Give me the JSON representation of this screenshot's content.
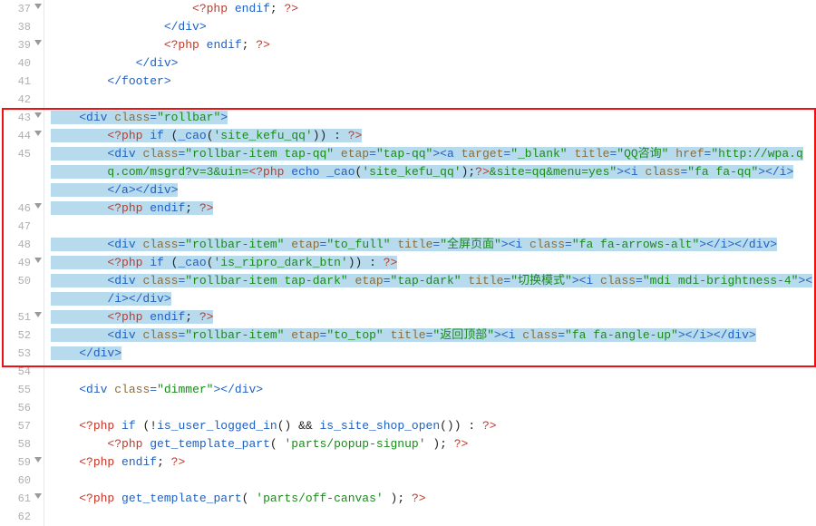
{
  "first_line_number": 37,
  "fold_lines": [
    37,
    39,
    43,
    44,
    46,
    49,
    51,
    59,
    61
  ],
  "selection": {
    "from": 43,
    "to": 53
  },
  "redbox": {
    "from": 43,
    "to": 53
  },
  "wrapped_lines": [
    45,
    48,
    50,
    52
  ],
  "lines": [
    {
      "n": 37,
      "ind": 5,
      "tokens": [
        [
          "php",
          "<?php"
        ],
        [
          "plain",
          " "
        ],
        [
          "kw",
          "endif"
        ],
        [
          "plain",
          "; "
        ],
        [
          "php",
          "?>"
        ]
      ]
    },
    {
      "n": 38,
      "ind": 4,
      "tokens": [
        [
          "tag",
          "</div>"
        ]
      ]
    },
    {
      "n": 39,
      "ind": 4,
      "tokens": [
        [
          "php",
          "<?php"
        ],
        [
          "plain",
          " "
        ],
        [
          "kw",
          "endif"
        ],
        [
          "plain",
          "; "
        ],
        [
          "php",
          "?>"
        ]
      ]
    },
    {
      "n": 40,
      "ind": 3,
      "tokens": [
        [
          "tag",
          "</div>"
        ]
      ]
    },
    {
      "n": 41,
      "ind": 2,
      "tokens": [
        [
          "tag",
          "</footer>"
        ]
      ]
    },
    {
      "n": 42,
      "ind": 0,
      "tokens": []
    },
    {
      "n": 43,
      "ind": 1,
      "tokens": [
        [
          "tag",
          "<div "
        ],
        [
          "attr",
          "class"
        ],
        [
          "tag",
          "="
        ],
        [
          "str",
          "\"rollbar\""
        ],
        [
          "tag",
          ">"
        ]
      ]
    },
    {
      "n": 44,
      "ind": 2,
      "tokens": [
        [
          "php",
          "<?php"
        ],
        [
          "plain",
          " "
        ],
        [
          "kw",
          "if"
        ],
        [
          "plain",
          " ("
        ],
        [
          "fn",
          "_cao"
        ],
        [
          "plain",
          "("
        ],
        [
          "str",
          "'site_kefu_qq'"
        ],
        [
          "plain",
          ")) : "
        ],
        [
          "php",
          "?>"
        ]
      ]
    },
    {
      "n": 45,
      "ind": 2,
      "tokens": [
        [
          "tag",
          "<div "
        ],
        [
          "attr",
          "class"
        ],
        [
          "tag",
          "="
        ],
        [
          "str",
          "\"rollbar-item tap-qq\""
        ],
        [
          "plain",
          " "
        ],
        [
          "attr",
          "etap"
        ],
        [
          "tag",
          "="
        ],
        [
          "str",
          "\"tap-qq\""
        ],
        [
          "tag",
          "><a "
        ],
        [
          "attr",
          "target"
        ],
        [
          "tag",
          "="
        ],
        [
          "str",
          "\"_blank\""
        ],
        [
          "plain",
          " "
        ],
        [
          "attr",
          "title"
        ],
        [
          "tag",
          "="
        ],
        [
          "str",
          "\"QQ咨询\""
        ],
        [
          "plain",
          " "
        ],
        [
          "attr",
          "href"
        ],
        [
          "tag",
          "="
        ],
        [
          "str",
          "\"http://wpa.qq.com/msgrd?v=3&uin="
        ],
        [
          "php",
          "<?php"
        ],
        [
          "plain",
          " "
        ],
        [
          "kw",
          "echo"
        ],
        [
          "plain",
          " "
        ],
        [
          "fn",
          "_cao"
        ],
        [
          "plain",
          "("
        ],
        [
          "str",
          "'site_kefu_qq'"
        ],
        [
          "plain",
          ");"
        ],
        [
          "php",
          "?>"
        ],
        [
          "str",
          "&site=qq&menu=yes\""
        ],
        [
          "tag",
          "><i "
        ],
        [
          "attr",
          "class"
        ],
        [
          "tag",
          "="
        ],
        [
          "str",
          "\"fa fa-qq\""
        ],
        [
          "tag",
          "></i></a></div>"
        ]
      ]
    },
    {
      "n": 46,
      "ind": 2,
      "tokens": [
        [
          "php",
          "<?php"
        ],
        [
          "plain",
          " "
        ],
        [
          "kw",
          "endif"
        ],
        [
          "plain",
          "; "
        ],
        [
          "php",
          "?>"
        ]
      ]
    },
    {
      "n": 47,
      "ind": 0,
      "tokens": []
    },
    {
      "n": 48,
      "ind": 2,
      "tokens": [
        [
          "tag",
          "<div "
        ],
        [
          "attr",
          "class"
        ],
        [
          "tag",
          "="
        ],
        [
          "str",
          "\"rollbar-item\""
        ],
        [
          "plain",
          " "
        ],
        [
          "attr",
          "etap"
        ],
        [
          "tag",
          "="
        ],
        [
          "str",
          "\"to_full\""
        ],
        [
          "plain",
          " "
        ],
        [
          "attr",
          "title"
        ],
        [
          "tag",
          "="
        ],
        [
          "str",
          "\"全屏页面\""
        ],
        [
          "tag",
          "><i "
        ],
        [
          "attr",
          "class"
        ],
        [
          "tag",
          "="
        ],
        [
          "str",
          "\"fa fa-arrows-alt\""
        ],
        [
          "tag",
          "></i></div>"
        ]
      ]
    },
    {
      "n": 49,
      "ind": 2,
      "tokens": [
        [
          "php",
          "<?php"
        ],
        [
          "plain",
          " "
        ],
        [
          "kw",
          "if"
        ],
        [
          "plain",
          " ("
        ],
        [
          "fn",
          "_cao"
        ],
        [
          "plain",
          "("
        ],
        [
          "str",
          "'is_ripro_dark_btn'"
        ],
        [
          "plain",
          ")) : "
        ],
        [
          "php",
          "?>"
        ]
      ]
    },
    {
      "n": 50,
      "ind": 2,
      "tokens": [
        [
          "tag",
          "<div "
        ],
        [
          "attr",
          "class"
        ],
        [
          "tag",
          "="
        ],
        [
          "str",
          "\"rollbar-item tap-dark\""
        ],
        [
          "plain",
          " "
        ],
        [
          "attr",
          "etap"
        ],
        [
          "tag",
          "="
        ],
        [
          "str",
          "\"tap-dark\""
        ],
        [
          "plain",
          " "
        ],
        [
          "attr",
          "title"
        ],
        [
          "tag",
          "="
        ],
        [
          "str",
          "\"切换模式\""
        ],
        [
          "tag",
          "><i "
        ],
        [
          "attr",
          "class"
        ],
        [
          "tag",
          "="
        ],
        [
          "str",
          "\"mdi mdi-brightness-4\""
        ],
        [
          "tag",
          "></i></div>"
        ]
      ]
    },
    {
      "n": 51,
      "ind": 2,
      "tokens": [
        [
          "php",
          "<?php"
        ],
        [
          "plain",
          " "
        ],
        [
          "kw",
          "endif"
        ],
        [
          "plain",
          "; "
        ],
        [
          "php",
          "?>"
        ]
      ]
    },
    {
      "n": 52,
      "ind": 2,
      "tokens": [
        [
          "tag",
          "<div "
        ],
        [
          "attr",
          "class"
        ],
        [
          "tag",
          "="
        ],
        [
          "str",
          "\"rollbar-item\""
        ],
        [
          "plain",
          " "
        ],
        [
          "attr",
          "etap"
        ],
        [
          "tag",
          "="
        ],
        [
          "str",
          "\"to_top\""
        ],
        [
          "plain",
          " "
        ],
        [
          "attr",
          "title"
        ],
        [
          "tag",
          "="
        ],
        [
          "str",
          "\"返回顶部\""
        ],
        [
          "tag",
          "><i "
        ],
        [
          "attr",
          "class"
        ],
        [
          "tag",
          "="
        ],
        [
          "str",
          "\"fa fa-angle-up\""
        ],
        [
          "tag",
          "></i></div>"
        ]
      ]
    },
    {
      "n": 53,
      "ind": 1,
      "tokens": [
        [
          "tag",
          "</div>"
        ]
      ]
    },
    {
      "n": 54,
      "ind": 0,
      "tokens": []
    },
    {
      "n": 55,
      "ind": 1,
      "tokens": [
        [
          "tag",
          "<div "
        ],
        [
          "attr",
          "class"
        ],
        [
          "tag",
          "="
        ],
        [
          "str",
          "\"dimmer\""
        ],
        [
          "tag",
          "></div>"
        ]
      ]
    },
    {
      "n": 56,
      "ind": 0,
      "tokens": []
    },
    {
      "n": 57,
      "ind": 1,
      "tokens": [
        [
          "php",
          "<?php"
        ],
        [
          "plain",
          " "
        ],
        [
          "kw",
          "if"
        ],
        [
          "plain",
          " (!"
        ],
        [
          "fn",
          "is_user_logged_in"
        ],
        [
          "plain",
          "() && "
        ],
        [
          "fn",
          "is_site_shop_open"
        ],
        [
          "plain",
          "()) : "
        ],
        [
          "php",
          "?>"
        ]
      ]
    },
    {
      "n": 58,
      "ind": 2,
      "tokens": [
        [
          "php",
          "<?php"
        ],
        [
          "plain",
          " "
        ],
        [
          "fn",
          "get_template_part"
        ],
        [
          "plain",
          "( "
        ],
        [
          "str",
          "'parts/popup-signup'"
        ],
        [
          "plain",
          " ); "
        ],
        [
          "php",
          "?>"
        ]
      ]
    },
    {
      "n": 59,
      "ind": 1,
      "tokens": [
        [
          "php",
          "<?php"
        ],
        [
          "plain",
          " "
        ],
        [
          "kw",
          "endif"
        ],
        [
          "plain",
          "; "
        ],
        [
          "php",
          "?>"
        ]
      ]
    },
    {
      "n": 60,
      "ind": 0,
      "tokens": []
    },
    {
      "n": 61,
      "ind": 1,
      "tokens": [
        [
          "php",
          "<?php"
        ],
        [
          "plain",
          " "
        ],
        [
          "fn",
          "get_template_part"
        ],
        [
          "plain",
          "( "
        ],
        [
          "str",
          "'parts/off-canvas'"
        ],
        [
          "plain",
          " ); "
        ],
        [
          "php",
          "?>"
        ]
      ]
    },
    {
      "n": 62,
      "ind": 0,
      "tokens": []
    }
  ],
  "indent_unit": "    ",
  "class_map": {
    "tag": "t-tag",
    "attr": "t-attr",
    "str": "t-str",
    "php": "t-php",
    "kw": "t-kw",
    "fn": "t-fn",
    "op": "t-op",
    "plain": "t-plain"
  }
}
